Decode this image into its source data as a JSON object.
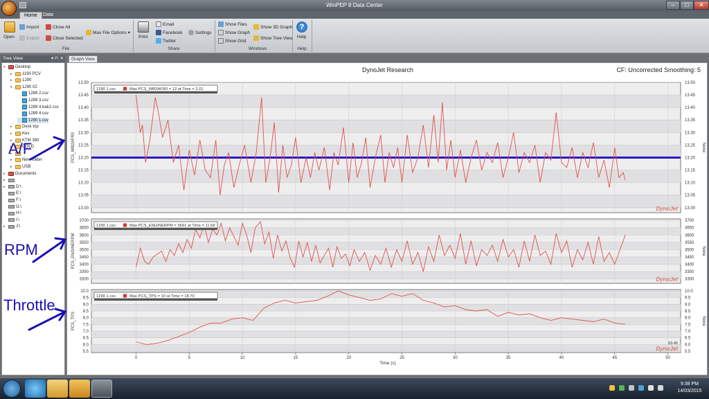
{
  "window": {
    "title": "WinPEP 8 Data Center",
    "min": "–",
    "max": "□",
    "close": "✕"
  },
  "tabs": [
    "Home",
    "Data"
  ],
  "ribbon": {
    "file": {
      "label": "File",
      "open": "Open",
      "import": "Import",
      "export": "Export",
      "close_all": "Close All",
      "close_selected": "Close Selected",
      "max_file_options": "Max File Options ▾"
    },
    "share": {
      "label": "Share",
      "print": "Print",
      "email": "Email",
      "facebook": "Facebook",
      "twitter": "Twitter",
      "settings": "Settings"
    },
    "windows": {
      "label": "Windows",
      "show_files": "Show Files",
      "show_graph": "Show Graph",
      "show_grid": "Show Grid",
      "show_3d_graph": "Show 3D Graph",
      "show_tree_view": "Show Tree View"
    },
    "help": {
      "label": "Help",
      "help": "Help"
    }
  },
  "tree": {
    "header": "Tree View",
    "pin": "▾ ⊓",
    "close": "✕",
    "items": [
      {
        "label": "Desktop",
        "level": 0,
        "type": "folder-red",
        "exp": "▾"
      },
      {
        "label": "1190 PCV",
        "level": 1,
        "type": "folder",
        "exp": "▸"
      },
      {
        "label": "1290",
        "level": 1,
        "type": "folder",
        "exp": "▸"
      },
      {
        "label": "1290 02",
        "level": 1,
        "type": "folder",
        "exp": "▾"
      },
      {
        "label": "1289 2.csv",
        "level": 2,
        "type": "csv",
        "exp": ""
      },
      {
        "label": "1289 3.csv",
        "level": 2,
        "type": "csv",
        "exp": ""
      },
      {
        "label": "1289 4.bak1.csv",
        "level": 2,
        "type": "csv",
        "exp": ""
      },
      {
        "label": "1289 4.csv",
        "level": 2,
        "type": "csv",
        "exp": ""
      },
      {
        "label": "1290 1.csv",
        "level": 2,
        "type": "csv",
        "exp": "",
        "selected": true
      },
      {
        "label": "Desk top",
        "level": 1,
        "type": "folder",
        "exp": "▸"
      },
      {
        "label": "Kev",
        "level": 1,
        "type": "folder",
        "exp": "▸"
      },
      {
        "label": "KTM 390",
        "level": 1,
        "type": "folder",
        "exp": "▸"
      },
      {
        "label": "GOLD",
        "level": 1,
        "type": "folder",
        "exp": "▸"
      },
      {
        "label": "",
        "level": 1,
        "type": "folder",
        "exp": "▸"
      },
      {
        "label": "New folder",
        "level": 1,
        "type": "folder",
        "exp": "▸"
      },
      {
        "label": "USB",
        "level": 1,
        "type": "folder",
        "exp": "▸"
      },
      {
        "label": "Documents",
        "level": 0,
        "type": "folder-red",
        "exp": "▸"
      },
      {
        "label": "",
        "level": 0,
        "type": "drive",
        "exp": "▸"
      },
      {
        "label": "D:\\",
        "level": 0,
        "type": "drive",
        "exp": "▸"
      },
      {
        "label": "E:\\",
        "level": 0,
        "type": "drive",
        "exp": ""
      },
      {
        "label": "F:\\",
        "level": 0,
        "type": "drive",
        "exp": ""
      },
      {
        "label": "G:\\",
        "level": 0,
        "type": "drive",
        "exp": ""
      },
      {
        "label": "H:\\",
        "level": 0,
        "type": "drive",
        "exp": ""
      },
      {
        "label": "I:\\",
        "level": 0,
        "type": "drive",
        "exp": ""
      },
      {
        "label": "J:\\",
        "level": 0,
        "type": "drive",
        "exp": "▸"
      }
    ]
  },
  "graph_tab": "Graph View",
  "chart_header": {
    "title": "DynoJet Research",
    "cf": "CF: Uncorrected Smoothing: 5",
    "xlabel": "Time (s)",
    "watermark": "DynoJet"
  },
  "annotations": {
    "af": "A/F",
    "rpm": "RPM",
    "throttle": "Throttle"
  },
  "colors": {
    "series": "#e0504a",
    "ref_line": "#2a18c2",
    "annot": "#1a0fb3"
  },
  "chart_data": [
    {
      "type": "line",
      "ylabel": "PCS_WB2AFR0",
      "right_label": "None",
      "legend_file": "1290 1.csv",
      "legend": "Max PCS_WB2AFR0 = 13 at Time = 2.01",
      "ylim": [
        12.98,
        13.5
      ],
      "yticks": [
        13.0,
        13.05,
        13.1,
        13.15,
        13.2,
        13.25,
        13.3,
        13.35,
        13.4,
        13.45,
        13.5
      ],
      "ref_line": 13.2,
      "x": [
        0.0,
        0.4,
        0.6,
        0.9,
        1.3,
        1.8,
        2.1,
        2.5,
        3.0,
        3.5,
        4.0,
        4.5,
        5.0,
        5.5,
        6.0,
        6.5,
        7.0,
        7.5,
        7.9,
        8.3,
        8.7,
        9.2,
        9.7,
        10.2,
        10.8,
        11.3,
        11.8,
        12.2,
        12.6,
        13.0,
        13.4,
        13.8,
        14.2,
        14.6,
        15.0,
        15.5,
        16.0,
        16.4,
        16.8,
        17.2,
        17.7,
        18.2,
        18.6,
        19.0,
        19.5,
        20.0,
        20.4,
        20.8,
        21.2,
        21.6,
        22.0,
        22.5,
        23.0,
        23.4,
        23.8,
        24.2,
        24.6,
        25.0,
        25.5,
        26.0,
        26.5,
        27.0,
        27.5,
        28.0,
        28.4,
        28.8,
        29.2,
        29.6,
        30.0,
        30.5,
        31.0,
        31.5,
        32.0,
        32.5,
        33.0,
        33.5,
        34.0,
        34.5,
        35.0,
        35.5,
        36.0,
        36.5,
        37.0,
        37.5,
        38.0,
        38.5,
        39.0,
        39.5,
        40.0,
        40.5,
        41.0,
        41.5,
        42.0,
        42.5,
        43.0,
        43.5,
        44.0,
        44.5,
        45.0,
        45.4,
        45.8,
        46.0
      ],
      "y": [
        13.45,
        13.3,
        13.33,
        13.18,
        13.27,
        13.44,
        13.38,
        13.28,
        13.35,
        13.18,
        13.25,
        13.07,
        13.23,
        13.13,
        13.27,
        13.15,
        13.12,
        13.27,
        13.05,
        13.17,
        13.22,
        13.08,
        13.17,
        13.25,
        13.1,
        13.22,
        13.44,
        13.1,
        13.2,
        13.34,
        13.06,
        13.25,
        13.12,
        13.17,
        13.28,
        13.1,
        13.2,
        13.12,
        13.22,
        13.15,
        13.24,
        13.07,
        13.22,
        13.17,
        13.32,
        13.1,
        13.26,
        13.12,
        13.18,
        13.28,
        13.08,
        13.2,
        13.29,
        13.1,
        13.22,
        13.16,
        13.24,
        13.1,
        13.29,
        13.14,
        13.2,
        13.33,
        13.16,
        13.37,
        13.18,
        13.42,
        13.15,
        13.27,
        13.12,
        13.23,
        13.1,
        13.2,
        13.27,
        13.15,
        13.22,
        13.18,
        13.26,
        13.12,
        13.2,
        13.3,
        13.14,
        13.22,
        13.18,
        13.25,
        13.1,
        13.22,
        13.19,
        13.38,
        13.18,
        13.16,
        13.24,
        13.12,
        13.22,
        13.16,
        13.26,
        13.12,
        13.19,
        13.08,
        13.24,
        13.12,
        13.14,
        13.11
      ]
    },
    {
      "type": "line",
      "ylabel": "PCS_ENGINERPM",
      "right_label": "None",
      "legend_file": "1290 1.csv",
      "legend": "Max PCS_ENGINERPM = 3691 at Time = 11.68",
      "ylim": [
        3270,
        3710
      ],
      "yticks": [
        3300,
        3350,
        3400,
        3450,
        3500,
        3550,
        3600,
        3650,
        3700
      ],
      "x": [
        0.0,
        0.4,
        0.8,
        1.2,
        1.6,
        2.0,
        2.4,
        2.8,
        3.2,
        3.6,
        4.0,
        4.4,
        4.8,
        5.2,
        5.6,
        6.0,
        6.4,
        6.8,
        7.2,
        7.6,
        8.0,
        8.4,
        8.8,
        9.2,
        9.6,
        10.0,
        10.4,
        10.8,
        11.2,
        11.7,
        12.1,
        12.5,
        12.9,
        13.3,
        13.7,
        14.1,
        14.5,
        14.9,
        15.3,
        15.7,
        16.1,
        16.5,
        16.9,
        17.3,
        17.7,
        18.1,
        18.5,
        18.9,
        19.3,
        19.7,
        20.1,
        20.5,
        21.0,
        21.5,
        22.0,
        22.5,
        23.0,
        23.5,
        24.0,
        24.5,
        25.0,
        25.5,
        26.0,
        26.5,
        27.0,
        27.5,
        28.0,
        28.5,
        29.0,
        29.5,
        30.0,
        30.5,
        31.0,
        31.5,
        32.0,
        32.5,
        33.0,
        33.5,
        34.0,
        34.5,
        35.0,
        35.5,
        36.0,
        36.5,
        37.0,
        37.5,
        38.0,
        38.5,
        39.0,
        39.5,
        40.0,
        40.5,
        41.0,
        41.5,
        42.0,
        42.5,
        43.0,
        43.5,
        44.0,
        44.5,
        45.0,
        45.5,
        46.0
      ],
      "y": [
        3380,
        3510,
        3420,
        3400,
        3450,
        3470,
        3490,
        3420,
        3500,
        3460,
        3540,
        3480,
        3570,
        3510,
        3640,
        3580,
        3670,
        3550,
        3640,
        3600,
        3680,
        3560,
        3650,
        3590,
        3530,
        3680,
        3600,
        3480,
        3650,
        3691,
        3540,
        3620,
        3440,
        3600,
        3490,
        3560,
        3440,
        3380,
        3560,
        3450,
        3550,
        3420,
        3530,
        3410,
        3460,
        3510,
        3380,
        3520,
        3440,
        3470,
        3390,
        3500,
        3420,
        3480,
        3360,
        3460,
        3400,
        3510,
        3380,
        3500,
        3420,
        3560,
        3400,
        3480,
        3350,
        3520,
        3420,
        3600,
        3460,
        3530,
        3440,
        3610,
        3400,
        3560,
        3390,
        3500,
        3460,
        3530,
        3420,
        3570,
        3450,
        3500,
        3380,
        3560,
        3420,
        3600,
        3460,
        3490,
        3400,
        3610,
        3480,
        3560,
        3380,
        3500,
        3430,
        3550,
        3400,
        3590,
        3420,
        3480,
        3400,
        3500,
        3600
      ]
    },
    {
      "type": "line",
      "ylabel": "PCS_TPS",
      "right_label": "None",
      "legend_file": "1290 1.csv",
      "legend": "Max PCS_TPS = 10 at Time = 18.70",
      "ylim": [
        5.4,
        10.1
      ],
      "yticks": [
        5.5,
        6.0,
        6.5,
        7.0,
        7.5,
        8.0,
        8.5,
        9.0,
        9.5,
        10.0
      ],
      "end_label": "63.45",
      "x": [
        0,
        1,
        2,
        3,
        4,
        5,
        6,
        7,
        8,
        9,
        10,
        11,
        12,
        13,
        14,
        15,
        16,
        17,
        18,
        19,
        20,
        21,
        22,
        23,
        24,
        25,
        26,
        27,
        28,
        29,
        30,
        31,
        32,
        33,
        34,
        35,
        36,
        37,
        38,
        39,
        40,
        41,
        42,
        43,
        44,
        45,
        46
      ],
      "y": [
        6.2,
        6.0,
        6.1,
        6.3,
        6.6,
        6.9,
        7.3,
        7.6,
        7.6,
        7.9,
        8.0,
        7.8,
        8.7,
        9.1,
        9.3,
        9.1,
        9.2,
        9.3,
        9.6,
        10.0,
        9.7,
        9.5,
        9.3,
        9.4,
        9.8,
        9.6,
        9.8,
        9.3,
        9.1,
        8.8,
        8.9,
        8.6,
        8.5,
        8.6,
        8.1,
        8.4,
        8.2,
        8.3,
        8.0,
        7.8,
        8.0,
        7.9,
        7.8,
        7.7,
        7.9,
        7.6,
        7.5
      ]
    }
  ],
  "x_axis": {
    "xlim": [
      -4.2,
      51.2
    ],
    "ticks": [
      0,
      5,
      10,
      15,
      20,
      25,
      30,
      35,
      40,
      45,
      50
    ]
  },
  "taskbar": {
    "time": "9:38 PM",
    "date": "14/03/2015"
  }
}
